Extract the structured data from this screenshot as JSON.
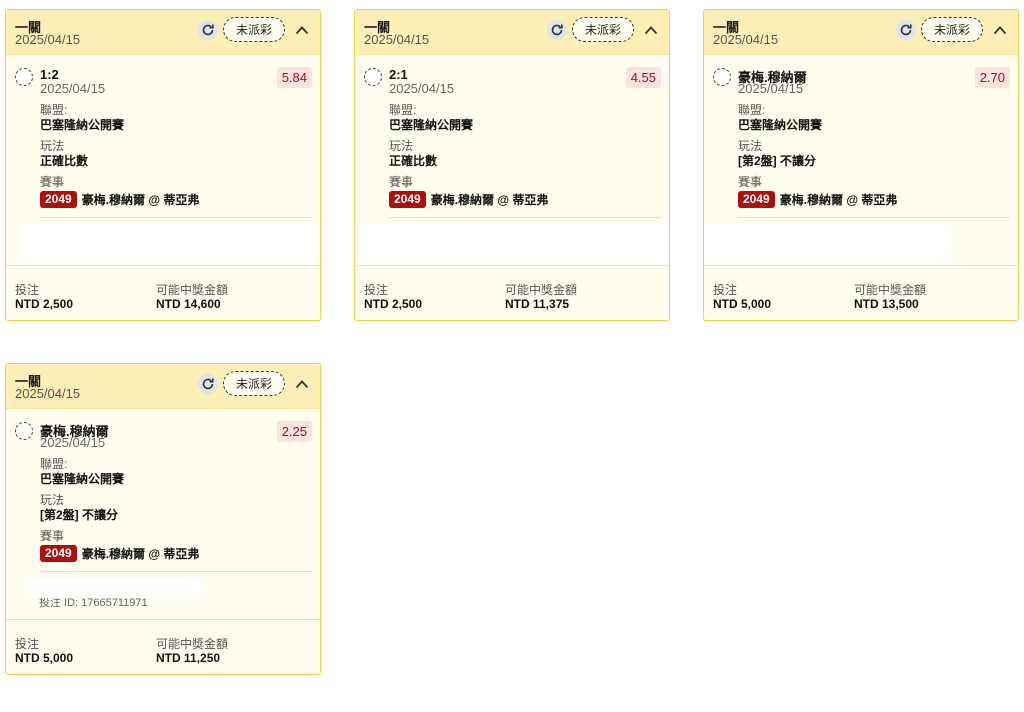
{
  "cards": [
    {
      "type": "一關",
      "date": "2025/04/15",
      "status": "未派彩",
      "selection": "1:2",
      "selection_date": "2025/04/15",
      "odds": "5.84",
      "league_label": "聯盟:",
      "league": "巴塞隆納公開賽",
      "market_label": "玩法",
      "market": "正確比數",
      "event_label": "賽事",
      "event_id": "2049",
      "event_name": "豪梅.穆納爾 @ 蒂亞弗",
      "stake_label": "投注",
      "stake": "NTD 2,500",
      "payout_label": "可能中獎金額",
      "payout": "NTD 14,600"
    },
    {
      "type": "一關",
      "date": "2025/04/15",
      "status": "未派彩",
      "selection": "2:1",
      "selection_date": "2025/04/15",
      "odds": "4.55",
      "league_label": "聯盟:",
      "league": "巴塞隆納公開賽",
      "market_label": "玩法",
      "market": "正確比數",
      "event_label": "賽事",
      "event_id": "2049",
      "event_name": "豪梅.穆納爾 @ 蒂亞弗",
      "stake_label": "投注",
      "stake": "NTD 2,500",
      "payout_label": "可能中獎金額",
      "payout": "NTD 11,375"
    },
    {
      "type": "一關",
      "date": "2025/04/15",
      "status": "未派彩",
      "selection": "豪梅.穆納爾",
      "selection_date": "2025/04/15",
      "odds": "2.70",
      "league_label": "聯盟:",
      "league": "巴塞隆納公開賽",
      "market_label": "玩法",
      "market": "[第2盤] 不讓分",
      "event_label": "賽事",
      "event_id": "2049",
      "event_name": "豪梅.穆納爾 @ 蒂亞弗",
      "stake_label": "投注",
      "stake": "NTD 5,000",
      "payout_label": "可能中獎金額",
      "payout": "NTD 13,500"
    },
    {
      "type": "一關",
      "date": "2025/04/15",
      "status": "未派彩",
      "selection": "豪梅.穆納爾",
      "selection_date": "2025/04/15",
      "odds": "2.25",
      "league_label": "聯盟:",
      "league": "巴塞隆納公開賽",
      "market_label": "玩法",
      "market": "[第2盤] 不讓分",
      "event_label": "賽事",
      "event_id": "2049",
      "event_name": "豪梅.穆納爾 @ 蒂亞弗",
      "stake_label": "投注",
      "stake": "NTD 5,000",
      "payout_label": "可能中獎金額",
      "payout": "NTD 11,250",
      "partial_text": "投注 ID: 17665711971"
    }
  ],
  "icons": {
    "refresh": "refresh-icon",
    "collapse": "chevron-up-icon"
  },
  "colors": {
    "card_border": "#f1d04c",
    "header_bg": "#fdefb5",
    "odds_text": "#b00d0d",
    "odds_bg": "#fbe3e2",
    "event_badge": "#b00d0d"
  }
}
